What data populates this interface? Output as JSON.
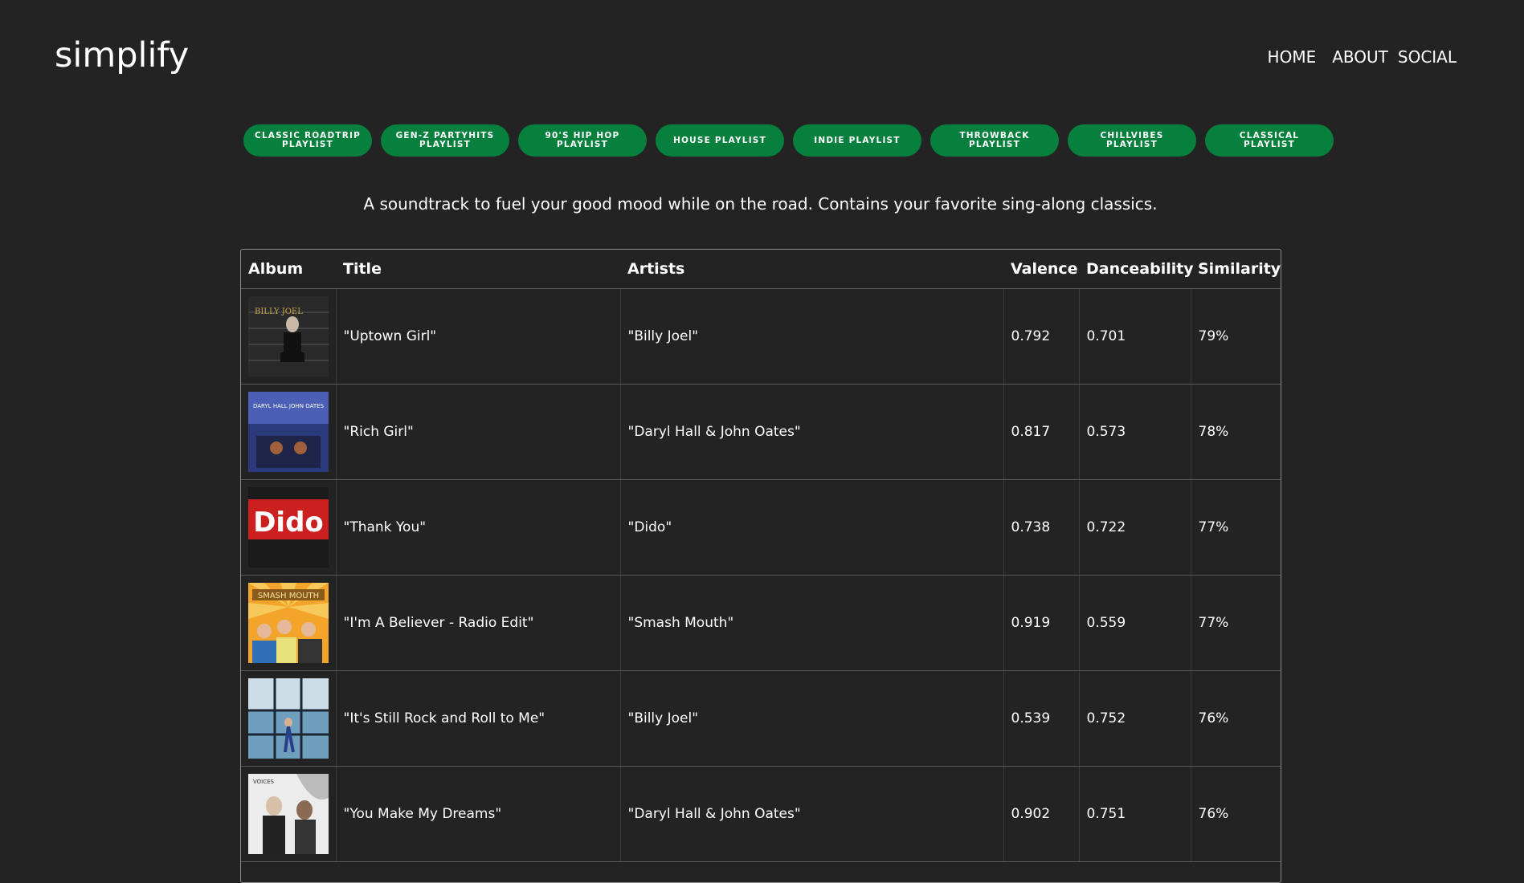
{
  "header": {
    "logo": "simplify",
    "nav": [
      {
        "label": "HOME"
      },
      {
        "label": "ABOUT"
      },
      {
        "label": "SOCIAL"
      }
    ]
  },
  "playlists": [
    {
      "label": "CLASSIC ROADTRIP PLAYLIST"
    },
    {
      "label": "GEN-Z PARTYHITS PLAYLIST"
    },
    {
      "label": "90'S HIP HOP PLAYLIST"
    },
    {
      "label": "HOUSE PLAYLIST"
    },
    {
      "label": "INDIE PLAYLIST"
    },
    {
      "label": "THROWBACK PLAYLIST"
    },
    {
      "label": "CHILLVIBES PLAYLIST"
    },
    {
      "label": "CLASSICAL PLAYLIST"
    }
  ],
  "description": "A soundtrack to fuel your good mood while on the road. Contains your favorite sing-along classics.",
  "table": {
    "columns": [
      "Album",
      "Title",
      "Artists",
      "Valence",
      "Danceability",
      "Similarity"
    ],
    "rows": [
      {
        "title": "\"Uptown Girl\"",
        "artists": "\"Billy Joel\"",
        "valence": "0.792",
        "danceability": "0.701",
        "similarity": "79%",
        "cover_text": "BILLY JOEL"
      },
      {
        "title": "\"Rich Girl\"",
        "artists": "\"Daryl Hall & John Oates\"",
        "valence": "0.817",
        "danceability": "0.573",
        "similarity": "78%",
        "cover_text": "DARYL HALL JOHN OATES"
      },
      {
        "title": "\"Thank You\"",
        "artists": "\"Dido\"",
        "valence": "0.738",
        "danceability": "0.722",
        "similarity": "77%",
        "cover_text": "Dido"
      },
      {
        "title": "\"I'm A Believer - Radio Edit\"",
        "artists": "\"Smash Mouth\"",
        "valence": "0.919",
        "danceability": "0.559",
        "similarity": "77%",
        "cover_text": "SMASH MOUTH"
      },
      {
        "title": "\"It's Still Rock and Roll to Me\"",
        "artists": "\"Billy Joel\"",
        "valence": "0.539",
        "danceability": "0.752",
        "similarity": "76%",
        "cover_text": ""
      },
      {
        "title": "\"You Make My Dreams\"",
        "artists": "\"Daryl Hall & John Oates\"",
        "valence": "0.902",
        "danceability": "0.751",
        "similarity": "76%",
        "cover_text": "VOICES"
      }
    ]
  },
  "colors": {
    "background": "#232323",
    "pill": "#07803d",
    "text": "#ffffff"
  }
}
